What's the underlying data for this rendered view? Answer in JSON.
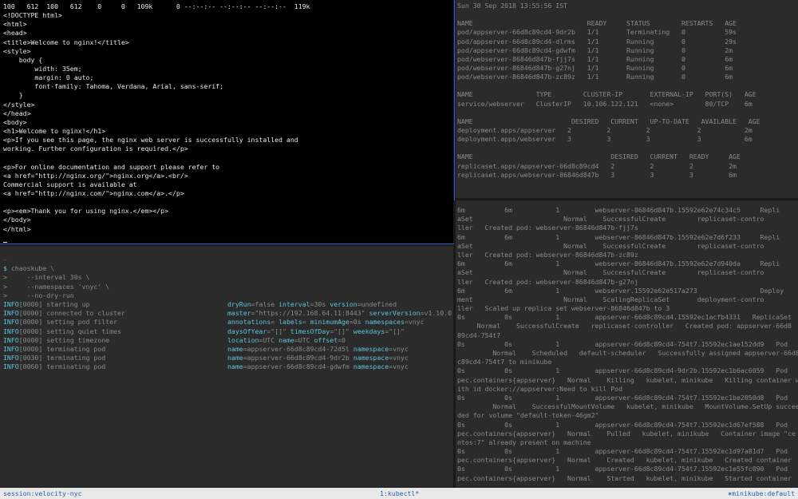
{
  "pane_curl": {
    "lines": [
      "100   612  100   612    0     0   109k      0 --:--:-- --:--:-- --:--:--  119k",
      "<!DOCTYPE html>",
      "<html>",
      "<head>",
      "<title>Welcome to nginx!</title>",
      "<style>",
      "    body {",
      "        width: 35em;",
      "        margin: 0 auto;",
      "        font-family: Tahoma, Verdana, Arial, sans-serif;",
      "    }",
      "</style>",
      "</head>",
      "<body>",
      "<h1>Welcome to nginx!</h1>",
      "<p>If you see this page, the nginx web server is successfully installed and",
      "working. Further configuration is required.</p>",
      "",
      "<p>For online documentation and support please refer to",
      "<a href=\"http://nginx.org/\">nginx.org</a>.<br/>",
      "Commercial support is available at",
      "<a href=\"http://nginx.com/\">nginx.com</a>.</p>",
      "",
      "<p><em>Thank you for using nginx.</em></p>",
      "</body>",
      "</html>"
    ]
  },
  "pane_kubectl": {
    "lines": [
      "Sun 30 Sep 2018 13:55:56 IST",
      "",
      "NAME                             READY     STATUS        RESTARTS   AGE",
      "pod/appserver-66d8c89cd4-9dr2b   1/1       Terminating   0          59s",
      "pod/appserver-66d8c89cd4-dlrms   1/1       Running       0          29s",
      "pod/appserver-66d8c89cd4-gdwfm   1/1       Running       0          2m",
      "pod/webserver-86846d847b-fjj7s   1/1       Running       0          6m",
      "pod/webserver-86846d847b-g27nj   1/1       Running       0          6m",
      "pod/webserver-86846d847b-zc89z   1/1       Running       0          6m",
      "",
      "NAME                TYPE        CLUSTER-IP       EXTERNAL-IP   PORT(S)   AGE",
      "service/webserver   ClusterIP   10.106.122.121   <none>        80/TCP    6m",
      "",
      "NAME                         DESIRED   CURRENT   UP-TO-DATE   AVAILABLE   AGE",
      "deployment.apps/appserver   2         2         2            2           2m",
      "deployment.apps/webserver   3         3         3            3           6m",
      "",
      "NAME                                   DESIRED   CURRENT   READY     AGE",
      "replicaset.apps/appserver-66d8c89cd4   2         2         2         2m",
      "replicaset.apps/webserver-86846d847b   3         3         3         6m"
    ]
  },
  "pane_chaos": {
    "tilde": "~",
    "prompt": "$",
    "command_lines": [
      " chaoskube \\",
      ">     --interval 30s \\",
      ">     --namespaces 'vnyc' \\",
      ">     --no-dry-run"
    ],
    "log": [
      {
        "level": "INFO",
        "code": "[0000]",
        "msg": "starting up",
        "fields": [
          [
            "dryRun",
            "false"
          ],
          [
            "interval",
            "30s"
          ],
          [
            "version",
            "undefined"
          ]
        ]
      },
      {
        "level": "INFO",
        "code": "[0000]",
        "msg": "connected to cluster",
        "fields": [
          [
            "master",
            "\"https://192.168.64.11:8443\""
          ],
          [
            "serverVersion",
            "v1.10.0"
          ]
        ]
      },
      {
        "level": "INFO",
        "code": "[0000]",
        "msg": "setting pod filter",
        "fields": [
          [
            "annotations",
            ""
          ],
          [
            "labels",
            ""
          ],
          [
            "minimumAge",
            "0s"
          ],
          [
            "namespaces",
            "vnyc"
          ]
        ]
      },
      {
        "level": "INFO",
        "code": "[0000]",
        "msg": "setting quiet times",
        "fields": [
          [
            "daysOfYear",
            "\"[]\""
          ],
          [
            "timesOfDay",
            "\"[]\""
          ],
          [
            "weekdays",
            "\"[]\""
          ]
        ]
      },
      {
        "level": "INFO",
        "code": "[0000]",
        "msg": "setting timezone",
        "fields": [
          [
            "location",
            "UTC"
          ],
          [
            "name",
            "UTC"
          ],
          [
            "offset",
            "0"
          ]
        ]
      },
      {
        "level": "INFO",
        "code": "[0000]",
        "msg": "terminating pod",
        "fields": [
          [
            "name",
            "appserver-66d8c89cd4-72d5l"
          ],
          [
            "namespace",
            "vnyc"
          ]
        ]
      },
      {
        "level": "INFO",
        "code": "[0030]",
        "msg": "terminating pod",
        "fields": [
          [
            "name",
            "appserver-66d8c89cd4-9dr2b"
          ],
          [
            "namespace",
            "vnyc"
          ]
        ]
      },
      {
        "level": "INFO",
        "code": "[0060]",
        "msg": "terminating pod",
        "fields": [
          [
            "name",
            "appserver-66d8c89cd4-gdwfm"
          ],
          [
            "namespace",
            "vnyc"
          ]
        ]
      }
    ]
  },
  "pane_events": {
    "lines": [
      "6m          6m           1         webserver-86846d847b.15592e62e74c34c5     Repli",
      "aSet                       Normal    SuccessfulCreate        replicaset-contro",
      "ller   Created pod: webserver-86846d847b-fjj7s",
      "6m          6m           1         webserver-86846d847b.15592e62e7d6f233     Repli",
      "aSet                       Normal    SuccessfulCreate        replicaset-contro",
      "ller   Created pod: webserver-86846d847b-zc89z",
      "6m          6m           1         webserver-86846d847b.15592e62e7d940da     Repli",
      "aSet                       Normal    SuccessfulCreate        replicaset-contro",
      "ller   Created pod: webserver-86846d847b-g27nj",
      "6m          6m           1         webserver.15592e62e517a273                Deploy",
      "ment                       Normal    ScalingReplicaSet       deployment-contro",
      "ller   Scaled up replica set webserver-86846d847b to 3",
      "0s          0s           1         appserver-66d8c89cd4.15592ec1acfb4331   ReplicaSet",
      "     Normal    SuccessfulCreate   replicaset-controller   Created pod: appserver-66d8",
      "89cd4-754t7",
      "0s          0s           1         appserver-66d8c89cd4-754t7.15592ec1ae152dd9   Pod",
      "         Normal    Scheduled   default-scheduler   Successfully assigned appserver-66d8",
      "c89cd4-754t7 to minikube",
      "0s          0s           1         appserver-66d8c89cd4-9dr2b.15592ec1b6ac6059   Pod    s",
      "pec.containers{appserver}   Normal    Killing   kubelet, minikube   Killing container w",
      "ith id docker://appserver:Need to kill Pod",
      "0s          0s           1         appserver-66d8c89cd4-754t7.15592ec1be2050d8   Pod",
      "         Normal    SuccessfulMountVolume   kubelet, minikube   MountVolume.SetUp succee",
      "ded for volume \"default-token-46gm2\"",
      "0s          0s           1         appserver-66d8c89cd4-754t7.15592ec1d67ef588   Pod    s",
      "pec.containers{appserver}   Normal    Pulled   kubelet, minikube   Container image \"ce",
      "ntos:7\" already present on machine",
      "0s          0s           1         appserver-66d8c89cd4-754t7.15592ec1d97a81d7   Pod    s",
      "pec.containers{appserver}   Normal    Created   kubelet, minikube   Created container",
      "0s          0s           1         appserver-66d8c89cd4-754t7.15592ec1e55fc090   Pod    s",
      "pec.containers{appserver}   Normal    Started   kubelet, minikube   Started container"
    ]
  },
  "statusbar": {
    "session": "session:velocity-nyc",
    "window": "1:kubectl*",
    "context_icon": "kubernetes-wheel-icon",
    "context_glyph": "⎈",
    "context": "minikube:default"
  },
  "colors": {
    "accent_cyan": "#5fc3d8",
    "pane_border_active": "#2f62d6",
    "status_text": "#2b5fa8"
  }
}
